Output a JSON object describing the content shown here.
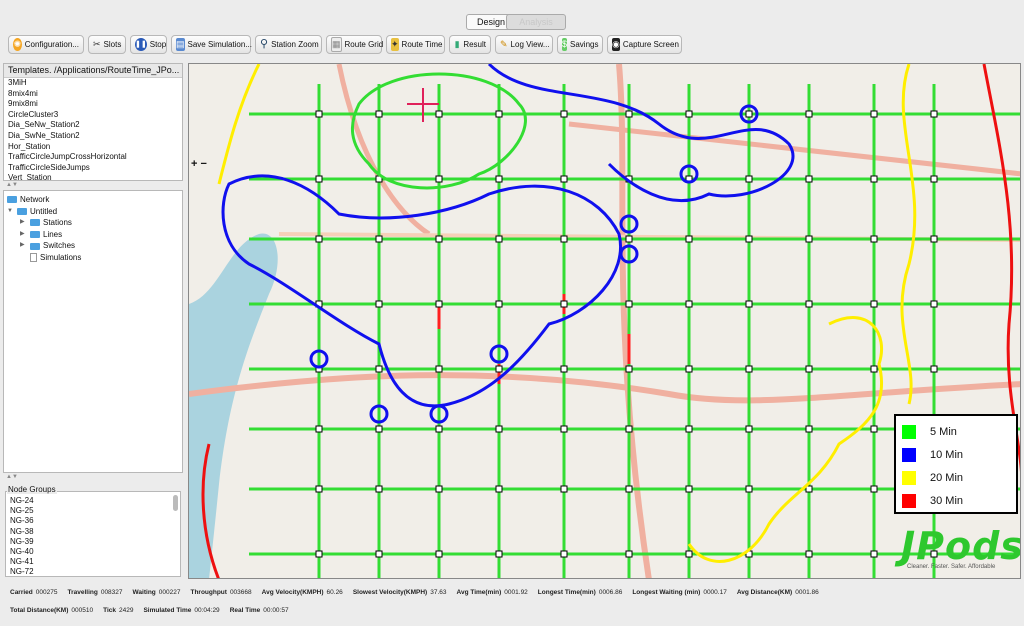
{
  "tabs": {
    "design": "Design",
    "analysis": "Analysis"
  },
  "toolbar": {
    "configuration": "Configuration...",
    "slots": "Slots",
    "stop": "Stop",
    "save_simulation": "Save Simulation...",
    "station_zoom": "Station Zoom",
    "route_grid": "Route Grid",
    "route_time": "Route Time",
    "result": "Result",
    "log_view": "Log View...",
    "savings": "Savings",
    "capture_screen": "Capture Screen"
  },
  "templates": {
    "title": "Templates. /Applications/RouteTime_JPo...",
    "items": [
      "3MiH",
      "8mix4mi",
      "9mix8mi",
      "CircleCluster3",
      "Dia_SeNw_Station2",
      "Dia_SwNe_Station2",
      "Hor_Station",
      "TrafficCircleJumpCrossHorizontal",
      "TrafficCircleSideJumps",
      "Vert_Station"
    ]
  },
  "network": {
    "root": "Network",
    "untitled": "Untitled",
    "children": [
      "Stations",
      "Lines",
      "Switches",
      "Simulations"
    ]
  },
  "node_groups": {
    "title": "Node Groups",
    "items": [
      "NG-24",
      "NG-25",
      "NG-36",
      "NG-38",
      "NG-39",
      "NG-40",
      "NG-41",
      "NG-72"
    ]
  },
  "legend": [
    {
      "label": "5 Min",
      "color": "#00ff00"
    },
    {
      "label": "10 Min",
      "color": "#0000ff"
    },
    {
      "label": "20 Min",
      "color": "#ffff00"
    },
    {
      "label": "30 Min",
      "color": "#ff0000"
    }
  ],
  "map": {
    "brand": "JPods",
    "tagline": "Cleaner. Faster. Safer. Affordable"
  },
  "status": {
    "row1": [
      {
        "label": "Carried",
        "value": "000275"
      },
      {
        "label": "Travelling",
        "value": "008327"
      },
      {
        "label": "Waiting",
        "value": "000227"
      },
      {
        "label": "Throughput",
        "value": "003668"
      },
      {
        "label": "Avg Velocity(KMPH)",
        "value": "60.26"
      },
      {
        "label": "Slowest Velocity(KMPH)",
        "value": "37.63"
      },
      {
        "label": "Avg Time(min)",
        "value": "0001.92"
      },
      {
        "label": "Longest Time(min)",
        "value": "0006.86"
      },
      {
        "label": "Longest Waiting (min)",
        "value": "0000.17"
      },
      {
        "label": "Avg Distance(KM)",
        "value": "0001.86"
      }
    ],
    "row2": [
      {
        "label": "Total Distance(KM)",
        "value": "000510"
      },
      {
        "label": "Tick",
        "value": "2429"
      },
      {
        "label": "Simulated Time",
        "value": "00:04:29"
      },
      {
        "label": "Real Time",
        "value": "00:00:57"
      }
    ]
  }
}
